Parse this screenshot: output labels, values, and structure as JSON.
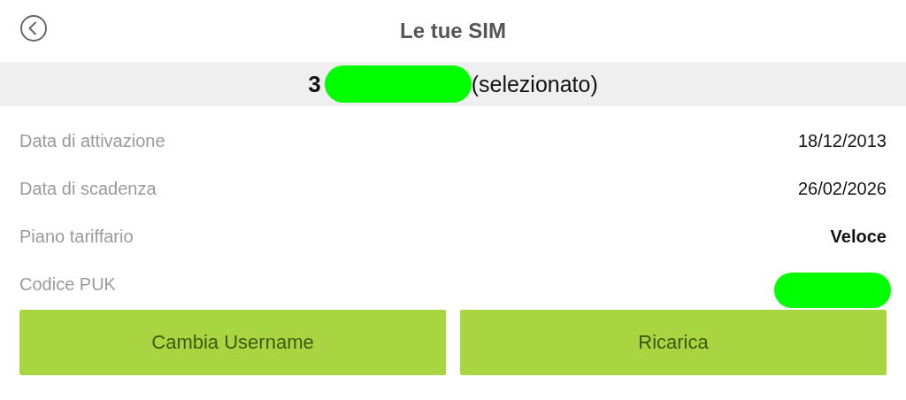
{
  "header": {
    "title": "Le tue SIM"
  },
  "sim": {
    "number": "3",
    "redacted": true,
    "status": "(selezionato)"
  },
  "details": [
    {
      "label": "Data di attivazione",
      "value": "18/12/2013",
      "emphasis": false
    },
    {
      "label": "Data di scadenza",
      "value": "26/02/2026",
      "emphasis": false
    },
    {
      "label": "Piano tariffario",
      "value": "Veloce",
      "emphasis": true
    },
    {
      "label": "Codice PUK",
      "redacted": true
    }
  ],
  "buttons": [
    "Cambia Username",
    "Ricarica"
  ]
}
